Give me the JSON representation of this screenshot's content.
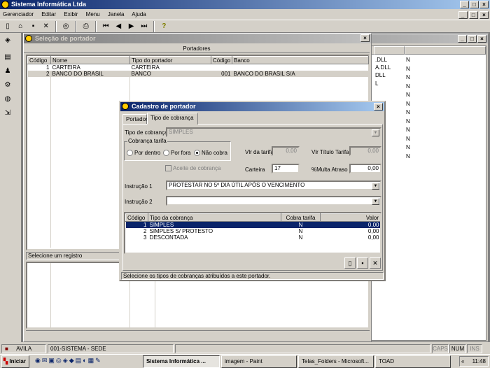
{
  "app": {
    "title": "Sistema Informática Ltda"
  },
  "menu": [
    "Gerenciador",
    "Editar",
    "Exibir",
    "Menu",
    "Janela",
    "Ajuda"
  ],
  "bg_window": {
    "col_fragments": [
      ".DLL",
      "",
      "A.DLL",
      "DLL",
      "",
      "",
      "",
      "",
      "L",
      "",
      "",
      ""
    ],
    "col_n": [
      "N",
      "N",
      "N",
      "N",
      "N",
      "N",
      "N",
      "N",
      "N",
      "N",
      "N",
      "N"
    ]
  },
  "portador_window": {
    "title": "Seleção de portador",
    "section": "Portadores",
    "columns": [
      "Código",
      "Nome",
      "Tipo do portador",
      "Código",
      "Banco"
    ],
    "rows": [
      [
        "1",
        "CARTEIRA",
        "CARTEIRA",
        "",
        ""
      ],
      [
        "2",
        "BANCO DO BRASIL",
        "BANCO",
        "001",
        "BANCO DO BRASIL S/A"
      ]
    ],
    "status": "Selecione um registro"
  },
  "dialog": {
    "title": "Cadastro de portador",
    "tabs": [
      "Portador",
      "Tipo de cobrança"
    ],
    "tipo_cobranca_label": "Tipo de cobrança",
    "tipo_cobranca_value": "SIMPLES",
    "cobranca_tarifa_group": "Cobrança tarifa",
    "radios": [
      "Por dentro",
      "Por fora",
      "Não cobra"
    ],
    "aceite_label": "Aceite de cobrança",
    "vlr_tarifa_label": "Vlr da tarifa",
    "vlr_tarifa_value": "0,00",
    "vlr_titulo_label": "Vlr Título Tarifa",
    "vlr_titulo_value": "0,00",
    "carteira_label": "Carteira",
    "carteira_value": "17",
    "multa_label": "%Multa Atraso",
    "multa_value": "0,00",
    "instrucao1_label": "Instrução 1",
    "instrucao1_value": "PROTESTAR NO 5º DIA ÚTIL APÓS O VENCIMENTO",
    "instrucao2_label": "Instrução 2",
    "instrucao2_value": "",
    "grid_columns": [
      "Código",
      "Tipo da cobrança",
      "Cobra tarifa",
      "Valor"
    ],
    "grid_rows": [
      [
        "1",
        "SIMPLES",
        "N",
        "0,00"
      ],
      [
        "2",
        "SIMPLES S/ PROTESTO",
        "N",
        "0,00"
      ],
      [
        "3",
        "DESCONTADA",
        "N",
        "0,00"
      ]
    ],
    "status": "Selecione os tipos de cobranças atribuídos a este portador."
  },
  "statusbar": {
    "user": "AVILA",
    "company": "001-SISTEMA - SEDE",
    "caps": "CAPS",
    "num": "NUM",
    "ins": "INS"
  },
  "taskbar": {
    "start": "Iniciar",
    "tasks": [
      "Sistema Informática ...",
      "imagem - Paint",
      "Telas_Folders - Microsoft...",
      "TOAD"
    ],
    "clock": "11:48"
  },
  "colors": {
    "title_active": "#0a246a",
    "title_inactive": "#808080",
    "face": "#d4d0c8",
    "selection": "#0a246a"
  }
}
